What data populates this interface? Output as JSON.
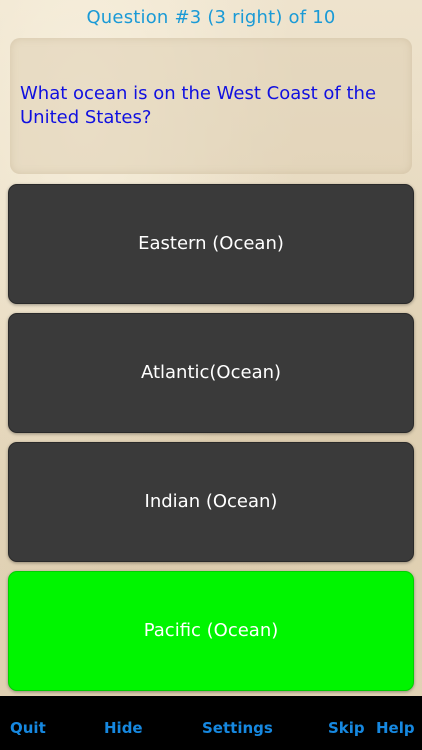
{
  "header": {
    "title": "Question #3 (3 right) of 10"
  },
  "question": {
    "text": "What ocean is on the West Coast of the United States?"
  },
  "answers": [
    {
      "label": "Eastern (Ocean)",
      "state": "default"
    },
    {
      "label": "Atlantic(Ocean)",
      "state": "default"
    },
    {
      "label": "Indian (Ocean)",
      "state": "default"
    },
    {
      "label": "Pacific (Ocean)",
      "state": "correct"
    }
  ],
  "toolbar": {
    "quit": "Quit",
    "hide": "Hide",
    "settings": "Settings",
    "skip": "Skip",
    "help": "Help"
  },
  "colors": {
    "header_text": "#1a9ad6",
    "question_text": "#1010e0",
    "answer_bg": "#3a3a3a",
    "correct_bg": "#00f500",
    "toolbar_bg": "#000000",
    "toolbar_text": "#1688e0"
  }
}
